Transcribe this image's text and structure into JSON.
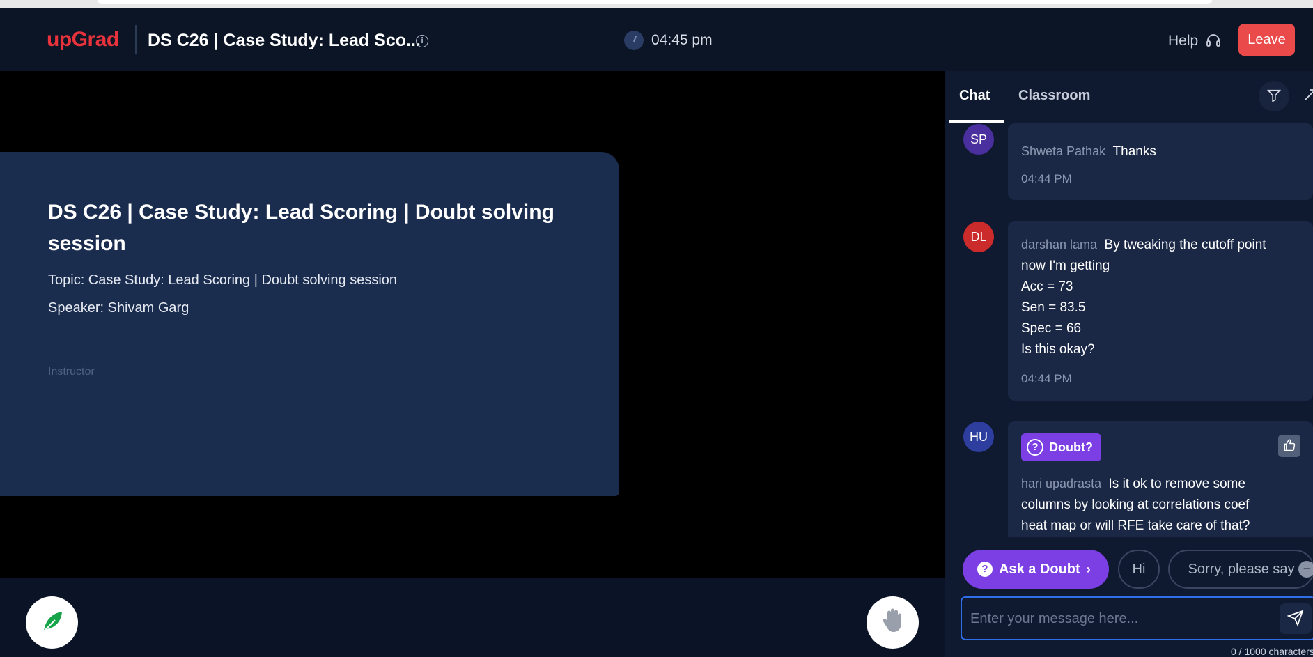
{
  "header": {
    "logo": "upGrad",
    "session_title": "DS C26 | Case Study: Lead Sco...",
    "info_icon": "info-icon",
    "time": "04:45 pm",
    "help_label": "Help",
    "leave_label": "Leave"
  },
  "card": {
    "title": "DS C26 | Case Study: Lead Scoring | Doubt solving session",
    "topic": "Topic: Case Study: Lead Scoring | Doubt solving session",
    "speaker": "Speaker: Shivam Garg",
    "role": "Instructor"
  },
  "chat": {
    "tabs": [
      "Chat",
      "Classroom"
    ],
    "messages": [
      {
        "initials": "SP",
        "avatar_color": "#4a2f9e",
        "author": "Shweta Pathak",
        "lines": [
          "Thanks"
        ],
        "time": "04:44 PM"
      },
      {
        "initials": "DL",
        "avatar_color": "#cc2b2b",
        "author": "darshan lama",
        "lines": [
          "By tweaking the cutoff point",
          "now I'm getting",
          "Acc = 73",
          "Sen = 83.5",
          "Spec = 66",
          "Is this okay?"
        ],
        "time": "04:44 PM"
      },
      {
        "initials": "HU",
        "avatar_color": "#2d3e9e",
        "badge": "Doubt?",
        "author": "hari upadrasta",
        "lines": [
          "Is it ok to remove some",
          "columns by looking at correlations coef",
          "heat map or will RFE take care of that?"
        ]
      }
    ],
    "ask_doubt_label": "Ask a Doubt",
    "quick_replies": [
      "Hi",
      "Sorry, please say"
    ],
    "input_placeholder": "Enter your message here...",
    "char_count": "0 / 1000 characters"
  },
  "colors": {
    "brand": "#e8323c",
    "leave": "#ea4a4a",
    "accent": "#7b3fe4",
    "input_border": "#2f6ee8"
  }
}
